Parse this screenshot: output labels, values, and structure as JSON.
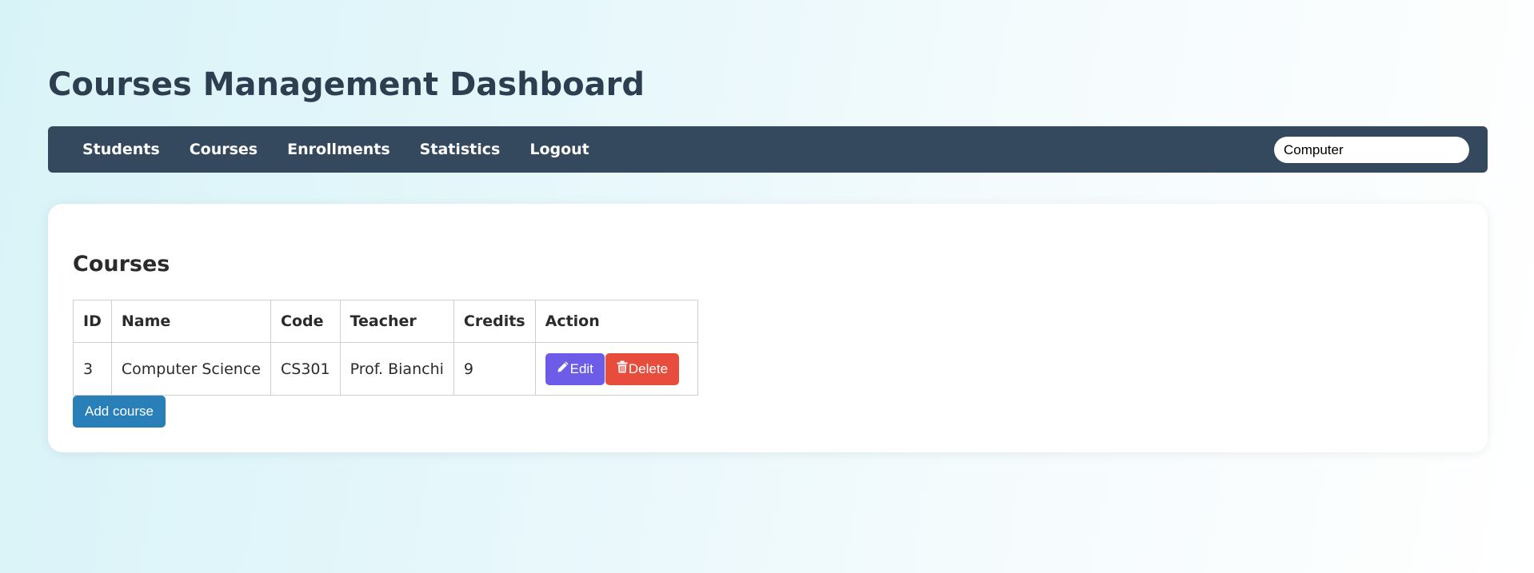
{
  "header": {
    "title": "Courses Management Dashboard"
  },
  "nav": {
    "items": [
      {
        "label": "Students"
      },
      {
        "label": "Courses"
      },
      {
        "label": "Enrollments"
      },
      {
        "label": "Statistics"
      },
      {
        "label": "Logout"
      }
    ],
    "search": {
      "value": "Computer",
      "placeholder": ""
    }
  },
  "main": {
    "section_title": "Courses",
    "table": {
      "columns": [
        "ID",
        "Name",
        "Code",
        "Teacher",
        "Credits",
        "Action"
      ],
      "rows": [
        {
          "id": "3",
          "name": "Computer Science",
          "code": "CS301",
          "teacher": "Prof. Bianchi",
          "credits": "9",
          "actions": {
            "edit_label": "Edit",
            "edit_icon": "pencil-icon",
            "delete_label": "Delete",
            "delete_icon": "trash-icon"
          }
        }
      ]
    },
    "add_button_label": "Add course"
  },
  "colors": {
    "navbar": "#34495e",
    "edit_button": "#6c5ce7",
    "delete_button": "#e74c3c",
    "add_button": "#2980b9",
    "title_text": "#2c3e50"
  }
}
